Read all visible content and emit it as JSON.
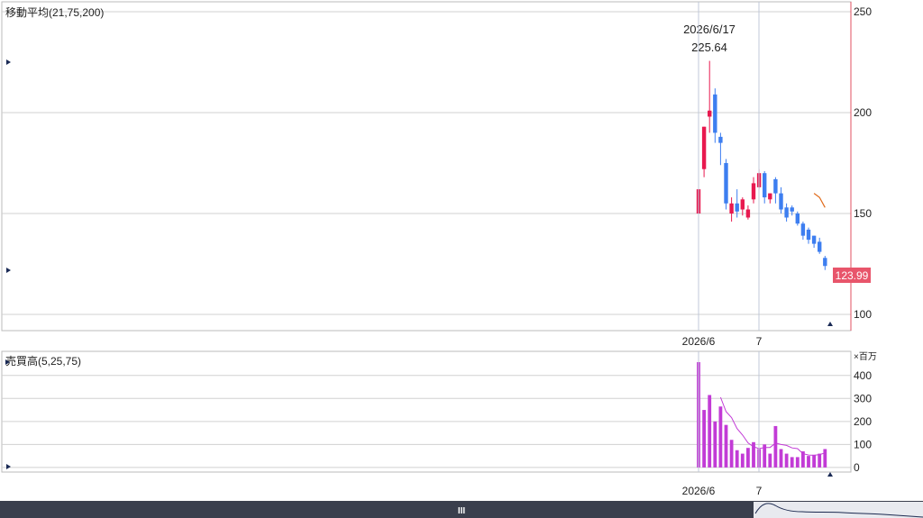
{
  "price_panel": {
    "indicator_label": "移動平均(21,75,200)",
    "last_price_label": "123.99",
    "tooltip": {
      "date": "2026/6/17",
      "value": "225.64"
    }
  },
  "volume_panel": {
    "indicator_label": "売買高(5,25,75)",
    "unit_label": "×百万"
  },
  "x_axis": {
    "labels": [
      "2026/6",
      "7"
    ]
  },
  "navigator": {
    "handle_glyph": "III"
  },
  "colors": {
    "up": "#e8194f",
    "down": "#3d7ef0",
    "volume": "#c23bd6",
    "ma_price": "#e06a1a",
    "ma_volume": "#c23bd6",
    "price_tag_bg": "#e8556b",
    "grid": "#d0d0d0",
    "frame": "#bbbbbb",
    "right_axis_line": "#e05060",
    "navigator_bg": "#3a3f4d",
    "nav_line": "#1c2a50"
  },
  "chart_data": [
    {
      "type": "candlestick",
      "ylim": [
        100,
        250
      ],
      "yticks": [
        100,
        150,
        200,
        250
      ],
      "candles": [
        {
          "o": 150,
          "h": 175,
          "l": 150,
          "c": 162
        },
        {
          "o": 172,
          "h": 193,
          "l": 168,
          "c": 193
        },
        {
          "o": 198,
          "h": 225.64,
          "l": 190,
          "c": 201
        },
        {
          "o": 209,
          "h": 212,
          "l": 185,
          "c": 190
        },
        {
          "o": 188,
          "h": 190,
          "l": 174,
          "c": 185
        },
        {
          "o": 175,
          "h": 177,
          "l": 152,
          "c": 155
        },
        {
          "o": 150,
          "h": 158,
          "l": 146,
          "c": 155
        },
        {
          "o": 155,
          "h": 162,
          "l": 148,
          "c": 151
        },
        {
          "o": 152,
          "h": 158,
          "l": 149,
          "c": 157
        },
        {
          "o": 148,
          "h": 154,
          "l": 147,
          "c": 152
        },
        {
          "o": 157,
          "h": 168,
          "l": 155,
          "c": 165
        },
        {
          "o": 163,
          "h": 172,
          "l": 162,
          "c": 170
        },
        {
          "o": 170,
          "h": 171,
          "l": 155,
          "c": 158
        },
        {
          "o": 157,
          "h": 160,
          "l": 155,
          "c": 160
        },
        {
          "o": 167,
          "h": 168,
          "l": 155,
          "c": 160
        },
        {
          "o": 160,
          "h": 163,
          "l": 150,
          "c": 152
        },
        {
          "o": 153,
          "h": 155,
          "l": 146,
          "c": 148
        },
        {
          "o": 153,
          "h": 154,
          "l": 149,
          "c": 151
        },
        {
          "o": 150,
          "h": 151,
          "l": 144,
          "c": 145
        },
        {
          "o": 145,
          "h": 146,
          "l": 137,
          "c": 139
        },
        {
          "o": 142,
          "h": 143,
          "l": 135,
          "c": 137
        },
        {
          "o": 139,
          "h": 139,
          "l": 133,
          "c": 135
        },
        {
          "o": 136,
          "h": 138,
          "l": 130,
          "c": 131
        },
        {
          "o": 128,
          "h": 129,
          "l": 122,
          "c": 124
        }
      ],
      "ma_series": [
        {
          "x_index": 21,
          "y": 160
        },
        {
          "x_index": 22,
          "y": 158
        },
        {
          "x_index": 23,
          "y": 153
        }
      ]
    },
    {
      "type": "bar",
      "ylim": [
        -20,
        450
      ],
      "yticks": [
        0,
        100,
        200,
        300,
        400
      ],
      "values": [
        510,
        250,
        315,
        200,
        265,
        185,
        120,
        75,
        60,
        85,
        110,
        80,
        100,
        60,
        180,
        80,
        60,
        45,
        45,
        70,
        50,
        55,
        60,
        80
      ],
      "ma_series": [
        {
          "x_index": 4,
          "y": 305
        },
        {
          "x_index": 5,
          "y": 243
        },
        {
          "x_index": 6,
          "y": 217
        },
        {
          "x_index": 7,
          "y": 169
        },
        {
          "x_index": 8,
          "y": 141
        },
        {
          "x_index": 9,
          "y": 107
        },
        {
          "x_index": 10,
          "y": 90
        },
        {
          "x_index": 11,
          "y": 82
        },
        {
          "x_index": 12,
          "y": 87
        },
        {
          "x_index": 13,
          "y": 87
        },
        {
          "x_index": 14,
          "y": 106
        },
        {
          "x_index": 15,
          "y": 100
        },
        {
          "x_index": 16,
          "y": 96
        },
        {
          "x_index": 17,
          "y": 85
        },
        {
          "x_index": 18,
          "y": 82
        },
        {
          "x_index": 19,
          "y": 60
        },
        {
          "x_index": 20,
          "y": 54
        },
        {
          "x_index": 21,
          "y": 53
        },
        {
          "x_index": 22,
          "y": 56
        },
        {
          "x_index": 23,
          "y": 63
        }
      ]
    }
  ]
}
